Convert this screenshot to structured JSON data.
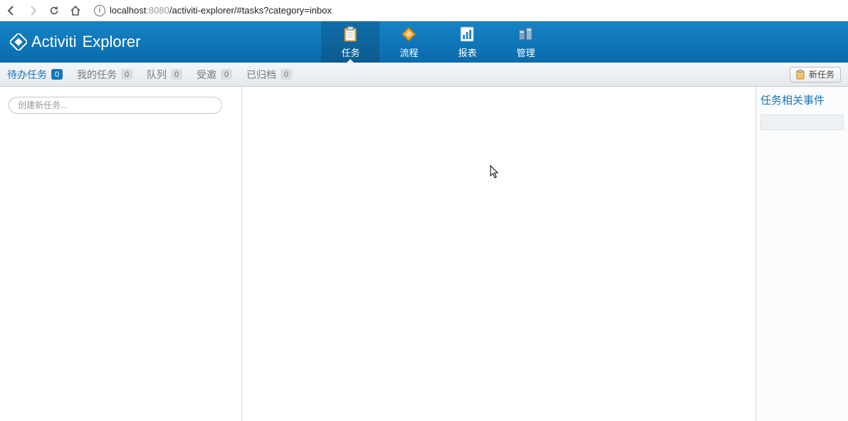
{
  "browser": {
    "url_host": "localhost",
    "url_port": ":8080",
    "url_path": "/activiti-explorer/#tasks?category=inbox"
  },
  "brand": {
    "text1": "Activiti",
    "text2": "Explorer"
  },
  "top_nav": [
    {
      "label": "任务",
      "icon": "clipboard",
      "active": true
    },
    {
      "label": "流程",
      "icon": "diamond",
      "active": false
    },
    {
      "label": "报表",
      "icon": "chart",
      "active": false
    },
    {
      "label": "管理",
      "icon": "servers",
      "active": false
    }
  ],
  "sub_tabs": [
    {
      "label": "待办任务",
      "count": "0",
      "active": true
    },
    {
      "label": "我的任务",
      "count": "0",
      "active": false
    },
    {
      "label": "队列",
      "count": "0",
      "active": false
    },
    {
      "label": "受邀",
      "count": "0",
      "active": false
    },
    {
      "label": "已归档",
      "count": "0",
      "active": false
    }
  ],
  "new_task_button": "新任务",
  "left_panel": {
    "create_placeholder": "创建新任务..."
  },
  "right_panel": {
    "title": "任务相关事件"
  }
}
